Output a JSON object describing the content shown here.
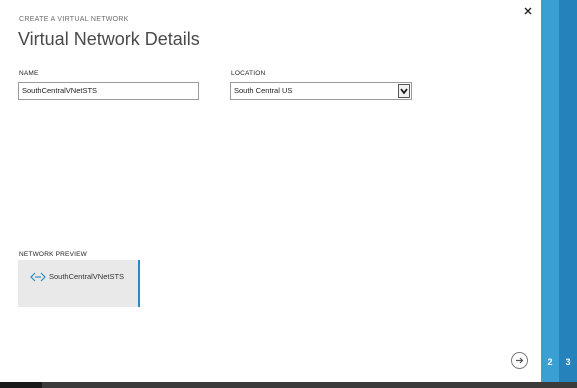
{
  "dialog": {
    "eyebrow": "CREATE A VIRTUAL NETWORK",
    "title": "Virtual Network Details",
    "close_icon": "close-icon"
  },
  "form": {
    "name_label": "NAME",
    "name_value": "SouthCentralVNetSTS",
    "location_label": "LOCATION",
    "location_value": "South Central US"
  },
  "preview": {
    "label": "NETWORK PREVIEW",
    "network_name": "SouthCentralVNetSTS",
    "icon": "virtual-network-icon"
  },
  "footer": {
    "next_icon": "arrow-right-icon",
    "steps": [
      "2",
      "3"
    ]
  },
  "colors": {
    "accent": "#2e8ac2",
    "step2": "#3aa0d4",
    "step3": "#2582ba"
  }
}
